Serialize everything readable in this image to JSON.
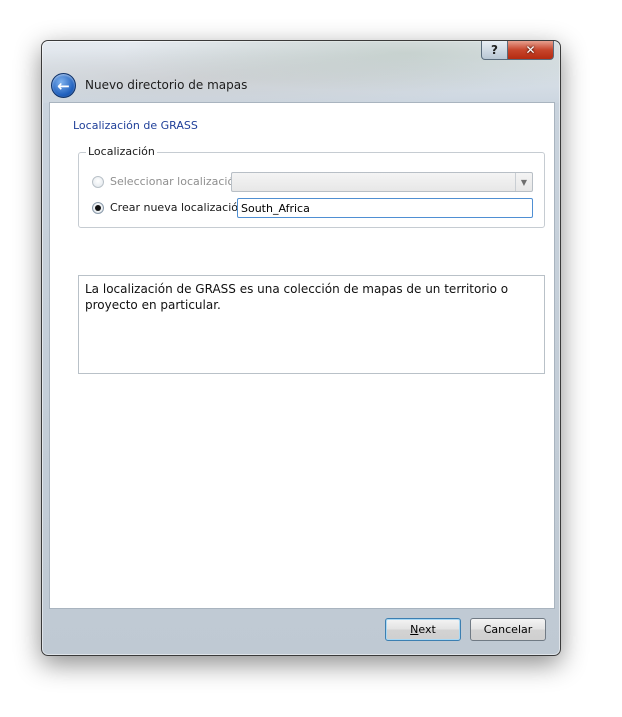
{
  "window": {
    "title": "Nuevo directorio de mapas",
    "help_glyph": "?",
    "close_glyph": "✕"
  },
  "page": {
    "subtitle": "Localización de GRASS"
  },
  "location_group": {
    "legend": "Localización",
    "select_option": {
      "label": "Seleccionar localización",
      "checked": false,
      "enabled": false
    },
    "combo": {
      "value": "",
      "arrow_glyph": "▼"
    },
    "create_option": {
      "label": "Crear nueva localización",
      "checked": true
    },
    "new_location_input": {
      "value": "South_Africa"
    }
  },
  "description": "La localización de GRASS es una colección de mapas de un territorio o proyecto en particular.",
  "buttons": {
    "next": "Next",
    "cancel": "Cancelar"
  },
  "colors": {
    "subtitle": "#1f3f99",
    "focus_border": "#4f8fd3"
  }
}
